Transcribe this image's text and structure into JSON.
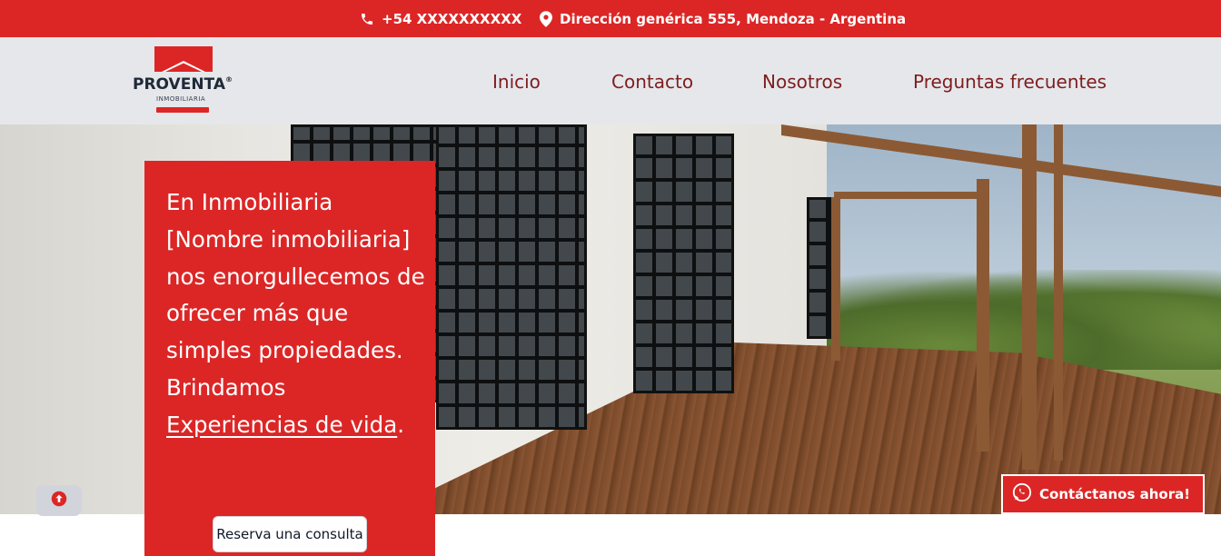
{
  "topbar": {
    "phone": "+54 XXXXXXXXXX",
    "address": "Dirección genérica 555, Mendoza - Argentina",
    "phone_icon": "phone-icon",
    "address_icon": "map-pin-icon"
  },
  "logo": {
    "brand": "PROVENTA",
    "registered": "®",
    "subtitle": "INMOBILIARIA"
  },
  "nav": {
    "items": [
      "Inicio",
      "Contacto",
      "Nosotros",
      "Preguntas frecuentes"
    ]
  },
  "hero": {
    "text_before": "En Inmobiliaria [Nombre inmobiliaria] nos enorgullecemos de ofrecer más que simples propiedades. Brindamos ",
    "link_text": "Experiencias de vida",
    "text_after": ".",
    "button_label": "Reserva una consulta"
  },
  "floating": {
    "scroll_top_icon": "arrow-up-circle-icon",
    "whatsapp_label": "Contáctanos ahora!",
    "whatsapp_icon": "whatsapp-icon"
  },
  "colors": {
    "brand_red": "#dc2626",
    "nav_text": "#7f1d1d",
    "nav_bg": "#e5e7eb"
  }
}
